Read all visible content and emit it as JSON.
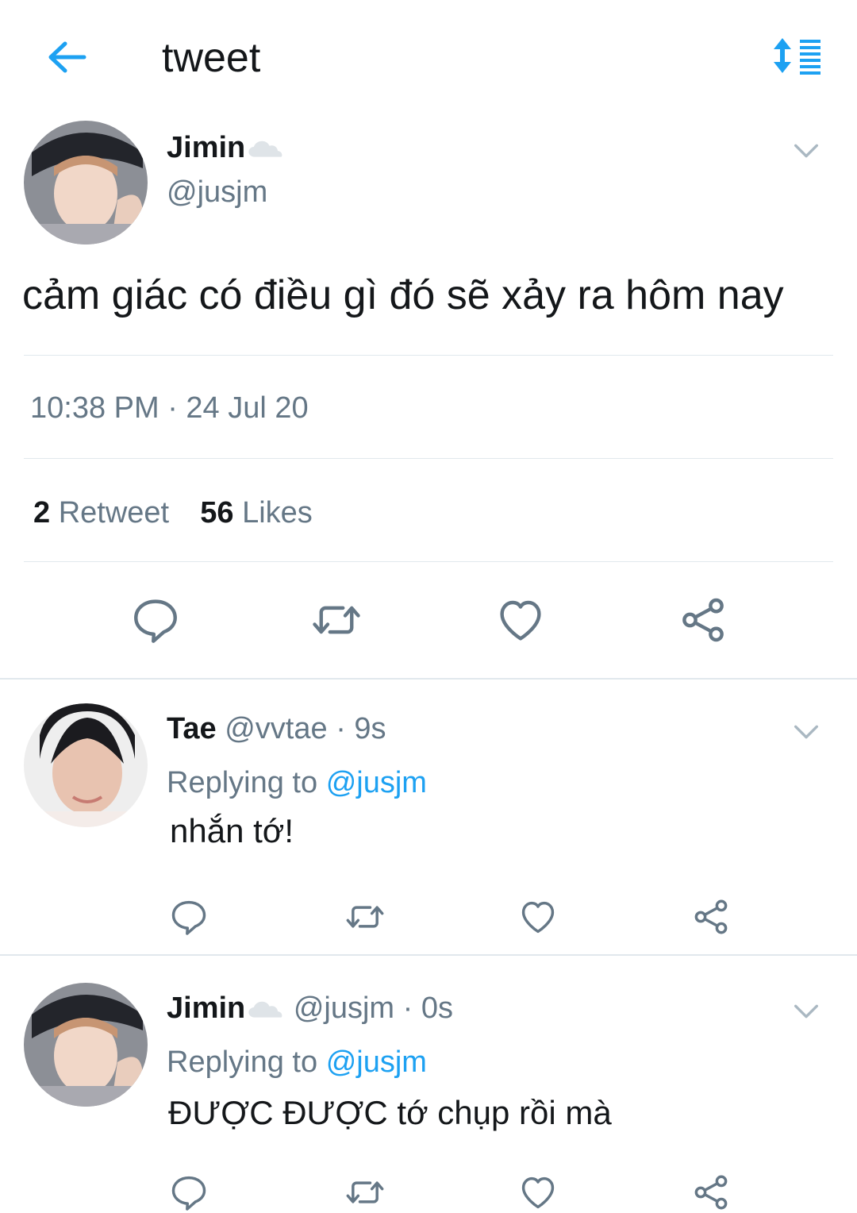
{
  "header": {
    "title": "tweet"
  },
  "main_tweet": {
    "name": "Jimin",
    "handle": "@jusjm",
    "text": "cảm giác có điều gì đó sẽ xảy ra hôm nay",
    "timestamp": "10:38 PM · 24 Jul 20",
    "retweets_count": "2",
    "retweets_label": "Retweet",
    "likes_count": "56",
    "likes_label": "Likes"
  },
  "replies": [
    {
      "name": "Tae",
      "handle": "@vvtae",
      "time": "· 9s",
      "replying_prefix": "Replying to",
      "replying_to": "@jusjm",
      "text": "nhắn tớ!"
    },
    {
      "name": "Jimin",
      "handle": "@jusjm",
      "time": "· 0s",
      "replying_prefix": "Replying to",
      "replying_to": "@jusjm",
      "text": "ĐƯỢC ĐƯỢC tớ chụp rồi mà"
    }
  ],
  "icons": {
    "back": "arrow-left-icon",
    "sort": "sort-icon",
    "menu": "chevron-down-icon",
    "reply": "reply-icon",
    "retweet": "retweet-icon",
    "like": "heart-icon",
    "share": "share-icon",
    "badge": "cloud-icon"
  },
  "colors": {
    "accent": "#1da1f2",
    "muted": "#657786",
    "icon": "#657786",
    "divider": "#e1e8ed"
  }
}
